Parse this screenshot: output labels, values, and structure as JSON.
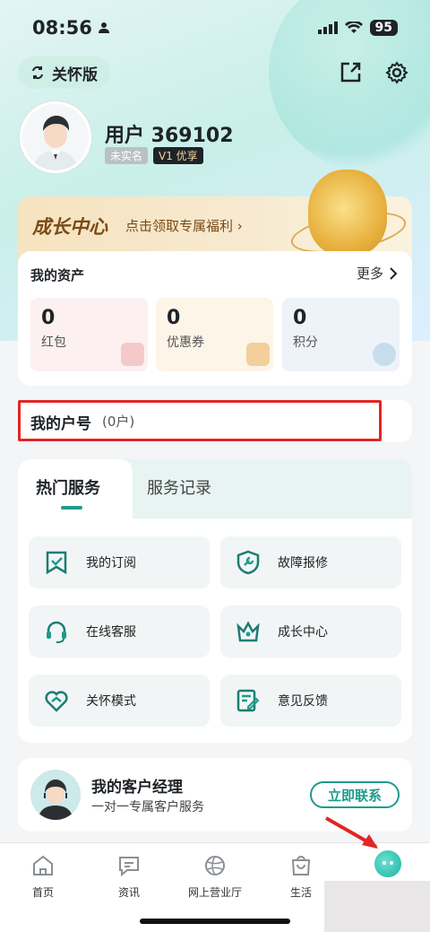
{
  "status": {
    "time": "08:56",
    "battery": "95"
  },
  "header": {
    "care_label": "关怀版"
  },
  "user": {
    "name": "用户 369102",
    "badge_unverified": "未实名",
    "badge_level": "V1 优享"
  },
  "growth": {
    "title": "成长中心",
    "subtitle": "点击领取专属福利 ›"
  },
  "assets": {
    "title": "我的资产",
    "more": "更多",
    "items": [
      {
        "value": "0",
        "label": "红包"
      },
      {
        "value": "0",
        "label": "优惠券"
      },
      {
        "value": "0",
        "label": "积分"
      }
    ]
  },
  "account": {
    "title": "我的户号",
    "count": "(0户)"
  },
  "services": {
    "tabs": [
      "热门服务",
      "服务记录"
    ],
    "items": [
      {
        "label": "我的订阅",
        "icon": "subscription-icon"
      },
      {
        "label": "故障报修",
        "icon": "repair-icon"
      },
      {
        "label": "在线客服",
        "icon": "headset-icon"
      },
      {
        "label": "成长中心",
        "icon": "crown-icon"
      },
      {
        "label": "关怀模式",
        "icon": "care-heart-icon"
      },
      {
        "label": "意见反馈",
        "icon": "feedback-icon"
      }
    ]
  },
  "manager": {
    "title": "我的客户经理",
    "subtitle": "一对一专属客户服务",
    "button": "立即联系"
  },
  "tabbar": [
    "首页",
    "资讯",
    "网上营业厅",
    "生活"
  ],
  "colors": {
    "accent": "#1c9b8c",
    "highlight": "#e22525"
  }
}
